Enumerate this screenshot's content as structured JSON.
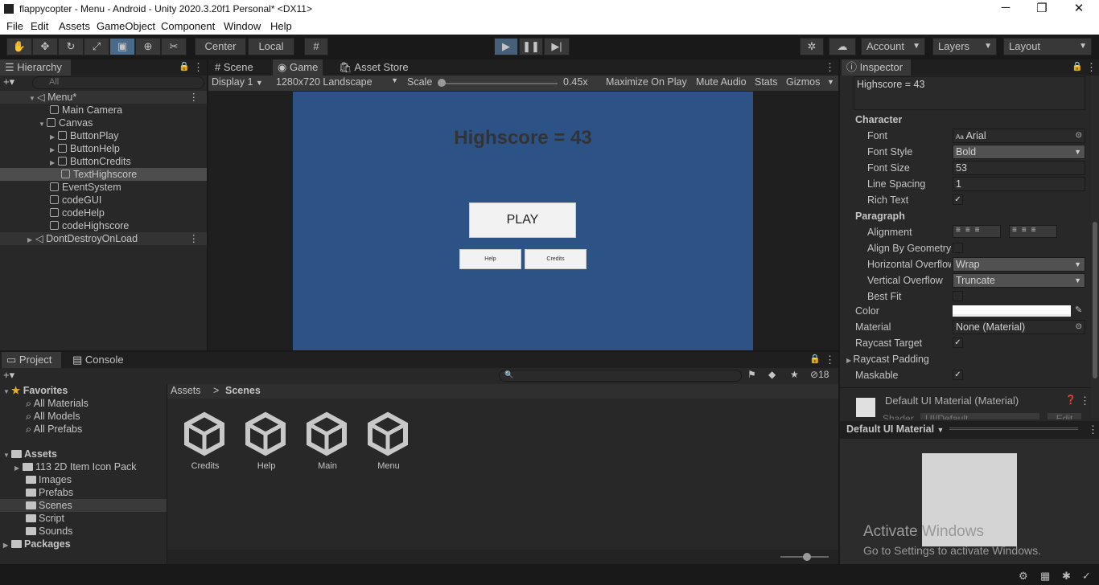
{
  "window": {
    "title": "flappycopter - Menu - Android - Unity 2020.3.20f1 Personal* <DX11>",
    "minimize": "─",
    "maximize": "❐",
    "close": "✕"
  },
  "menubar": [
    "File",
    "Edit",
    "Assets",
    "GameObject",
    "Component",
    "Window",
    "Help"
  ],
  "toolbar": {
    "pivot": "Center",
    "space": "Local",
    "account": "Account",
    "layers": "Layers",
    "layout": "Layout"
  },
  "hierarchy": {
    "tab": "Hierarchy",
    "search_placeholder": "All",
    "items": [
      {
        "label": "Menu*"
      },
      {
        "label": "Main Camera"
      },
      {
        "label": "Canvas"
      },
      {
        "label": "ButtonPlay"
      },
      {
        "label": "ButtonHelp"
      },
      {
        "label": "ButtonCredits"
      },
      {
        "label": "TextHighscore"
      },
      {
        "label": "EventSystem"
      },
      {
        "label": "codeGUI"
      },
      {
        "label": "codeHelp"
      },
      {
        "label": "codeHighscore"
      },
      {
        "label": "DontDestroyOnLoad"
      }
    ]
  },
  "game": {
    "tabs": {
      "scene": "Scene",
      "game": "Game",
      "store": "Asset Store"
    },
    "display": "Display 1",
    "resolution": "1280x720 Landscape",
    "scale_label": "Scale",
    "scale_value": "0.45x",
    "maximize": "Maximize On Play",
    "mute": "Mute Audio",
    "stats": "Stats",
    "gizmos": "Gizmos",
    "highscore": "Highscore = 43",
    "play": "PLAY",
    "help": "Help",
    "credits": "Credits",
    "bg_color": "#2d5286"
  },
  "inspector": {
    "tab": "Inspector",
    "text_value": "Highscore = 43",
    "character_header": "Character",
    "font_label": "Font",
    "font_value": "Arial",
    "font_icon_text": "Aa",
    "font_style_label": "Font Style",
    "font_style_value": "Bold",
    "font_size_label": "Font Size",
    "font_size_value": "53",
    "line_spacing_label": "Line Spacing",
    "line_spacing_value": "1",
    "rich_text_label": "Rich Text",
    "paragraph_header": "Paragraph",
    "alignment_label": "Alignment",
    "align_geo_label": "Align By Geometry",
    "h_overflow_label": "Horizontal Overflow",
    "h_overflow_value": "Wrap",
    "v_overflow_label": "Vertical Overflow",
    "v_overflow_value": "Truncate",
    "best_fit_label": "Best Fit",
    "color_label": "Color",
    "material_label": "Material",
    "material_value": "None (Material)",
    "raycast_target_label": "Raycast Target",
    "raycast_padding_label": "Raycast Padding",
    "maskable_label": "Maskable",
    "default_material_title": "Default UI Material (Material)",
    "shader_label": "Shader",
    "shader_value": "UI/Default",
    "edit_label": "Edit",
    "preview_dropdown": "Default UI Material",
    "watermark_title": "Activate Windows",
    "watermark_sub": "Go to Settings to activate Windows."
  },
  "project": {
    "tab_project": "Project",
    "tab_console": "Console",
    "hidden_count": "18",
    "breadcrumb_root": "Assets",
    "breadcrumb_sep": ">",
    "breadcrumb_current": "Scenes",
    "favorites": "Favorites",
    "fav_items": [
      "All Materials",
      "All Models",
      "All Prefabs"
    ],
    "assets": "Assets",
    "folders": [
      "113 2D Item Icon Pack",
      "Images",
      "Prefabs",
      "Scenes",
      "Script",
      "Sounds"
    ],
    "packages": "Packages",
    "scene_files": [
      "Credits",
      "Help",
      "Main",
      "Menu"
    ]
  }
}
